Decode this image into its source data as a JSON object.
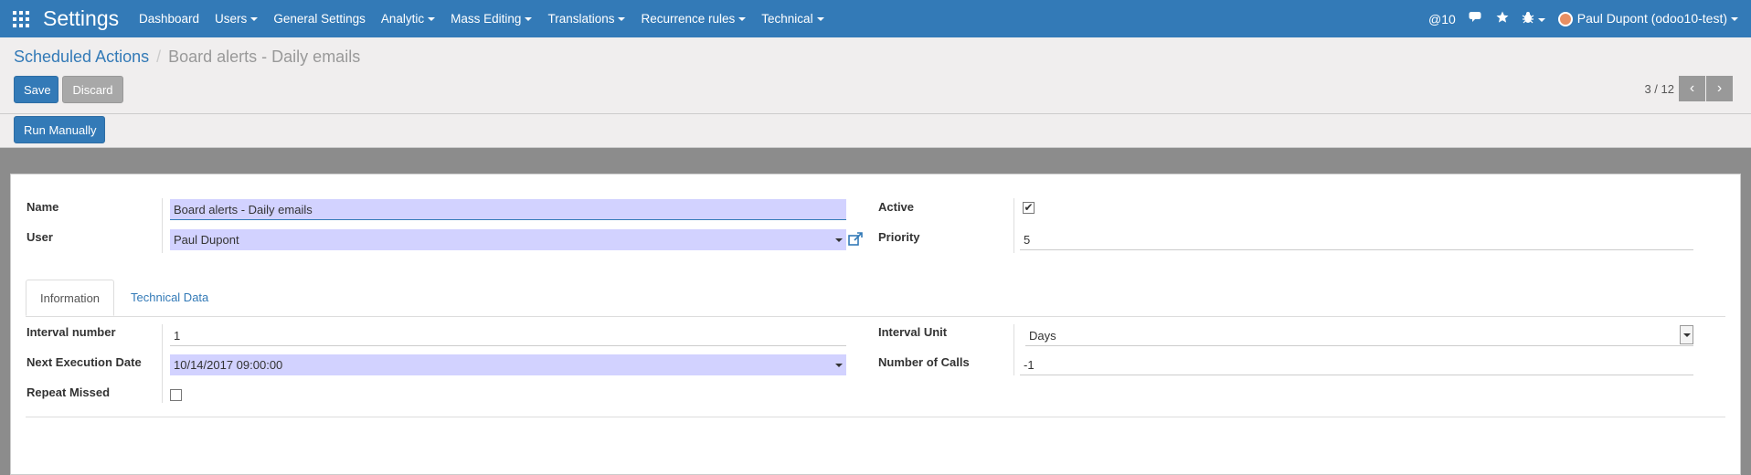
{
  "topbar": {
    "brand": "Settings",
    "menu": [
      "Dashboard",
      "Users",
      "General Settings",
      "Analytic",
      "Mass Editing",
      "Translations",
      "Recurrence rules",
      "Technical"
    ],
    "menu_has_caret": [
      false,
      true,
      false,
      true,
      true,
      true,
      true,
      true
    ],
    "notification_count": "@10",
    "user": "Paul Dupont (odoo10-test)",
    "icons": [
      "apps-icon",
      "chat-icon",
      "star-icon",
      "bug-icon",
      "avatar"
    ]
  },
  "breadcrumb": {
    "parent": "Scheduled Actions",
    "separator": "/",
    "current": "Board alerts - Daily emails"
  },
  "buttons": {
    "save": "Save",
    "discard": "Discard",
    "run_manually": "Run Manually"
  },
  "pager": {
    "value": "3 / 12"
  },
  "form": {
    "name_label": "Name",
    "name_value": "Board alerts - Daily emails",
    "user_label": "User",
    "user_value": "Paul Dupont",
    "active_label": "Active",
    "active_checked": true,
    "priority_label": "Priority",
    "priority_value": "5"
  },
  "tabs": [
    "Information",
    "Technical Data"
  ],
  "info": {
    "interval_number_label": "Interval number",
    "interval_number_value": "1",
    "next_exec_label": "Next Execution Date",
    "next_exec_value": "10/14/2017 09:00:00",
    "repeat_missed_label": "Repeat Missed",
    "repeat_missed_checked": false,
    "interval_unit_label": "Interval Unit",
    "interval_unit_value": "Days",
    "number_of_calls_label": "Number of Calls",
    "number_of_calls_value": "-1"
  },
  "colors": {
    "brand": "#337ab7",
    "required_field": "#d2d2ff",
    "discard": "#a8a8a8"
  }
}
